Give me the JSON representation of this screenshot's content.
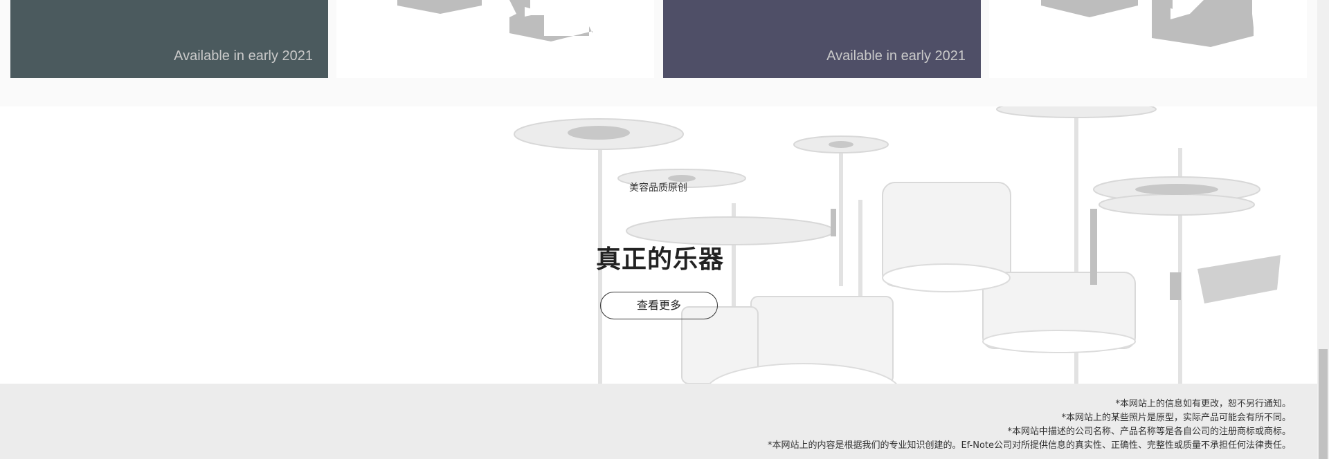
{
  "products": {
    "cards": [
      {
        "note": "Available in early 2021",
        "bg": "#4b5a5e"
      },
      {
        "note": "",
        "bg": "#ffffff"
      },
      {
        "note": "Available in early 2021",
        "bg": "#4f4f67"
      },
      {
        "note": "",
        "bg": "#ffffff"
      }
    ]
  },
  "hero": {
    "subtitle": "美容品质原创",
    "title": "真正的乐器",
    "button_label": "查看更多"
  },
  "footer": {
    "disclaimers": [
      "*本网站上的信息如有更改，恕不另行通知。",
      "*本网站上的某些照片是原型，实际产品可能会有所不同。",
      "*本网站中描述的公司名称、产品名称等是各自公司的注册商标或商标。",
      "*本网站上的内容是根据我们的专业知识创建的。Ef-Note公司对所提供信息的真实性、正确性、完整性或质量不承担任何法律责任。"
    ]
  },
  "colors": {
    "card_green": "#4b5a5e",
    "card_purple": "#4f4f67",
    "footer_bg": "#ececec"
  }
}
